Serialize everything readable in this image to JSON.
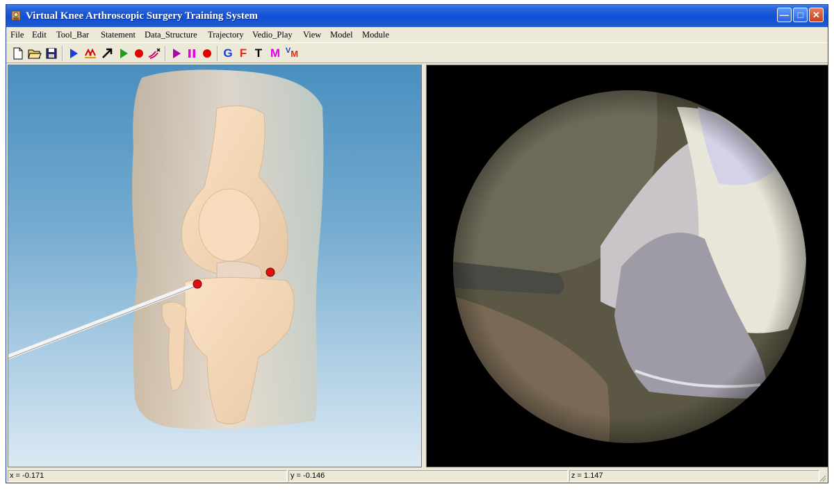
{
  "window": {
    "title": "Virtual Knee Arthroscopic Surgery Training System",
    "controls": [
      "minimize",
      "maximize",
      "close"
    ]
  },
  "menu": [
    "File",
    "Edit",
    "Tool_Bar",
    "Statement",
    "Data_Structure",
    "Trajectory",
    "Vedio_Play",
    "View",
    "Model",
    "Module"
  ],
  "toolbar": {
    "letters": {
      "g": "G",
      "f": "F",
      "t": "T",
      "m": "M",
      "vm_v": "V",
      "vm_m": "M"
    },
    "colors": {
      "play": "#1c3ed6",
      "green": "#1aa01a",
      "record": "#e00000",
      "magenta": "#e000e0",
      "pause": "#b000b0",
      "blue": "#1c3ed6"
    },
    "icons": [
      "new-file-icon",
      "open-folder-icon",
      "save-disk-icon",
      "play-icon",
      "trajectory-icon",
      "arrow-icon",
      "play-green-icon",
      "record-icon",
      "cut-icon",
      "play-purple-icon",
      "pause-icon",
      "record-stop-icon",
      "g-icon",
      "f-icon",
      "t-icon",
      "m-icon",
      "vm-icon"
    ]
  },
  "views": {
    "left": "3D knee model view",
    "right": "arthroscopic camera view"
  },
  "status": {
    "x": "x = -0.171",
    "y": "y = -0.146",
    "z": "z = 1.147"
  }
}
